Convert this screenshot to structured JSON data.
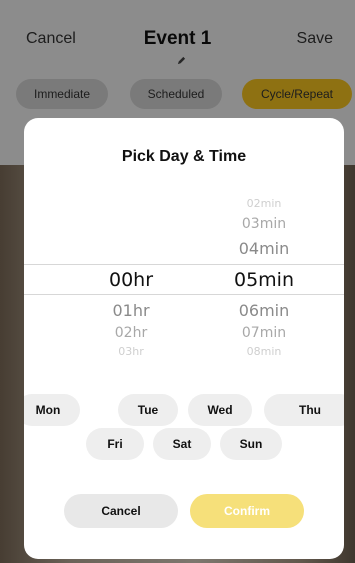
{
  "header": {
    "cancel_label": "Cancel",
    "title": "Event 1",
    "save_label": "Save",
    "edit_icon": "pencil-icon"
  },
  "modes": [
    {
      "label": "Immediate",
      "active": false
    },
    {
      "label": "Scheduled",
      "active": false
    },
    {
      "label": "Cycle/Repeat",
      "active": true
    }
  ],
  "modal": {
    "title": "Pick Day & Time",
    "hours": [
      "00hr",
      "01hr",
      "02hr",
      "03hr"
    ],
    "minutes": [
      "02min",
      "03min",
      "04min",
      "05min",
      "06min",
      "07min",
      "08min"
    ],
    "selected_hour": "00hr",
    "selected_minute": "05min",
    "days": [
      "Mon",
      "Tue",
      "Wed",
      "Thu",
      "Fri",
      "Sat",
      "Sun"
    ],
    "cancel_label": "Cancel",
    "confirm_label": "Confirm"
  },
  "colors": {
    "accent": "#f4c320",
    "confirm_disabled": "#f6e07a"
  }
}
